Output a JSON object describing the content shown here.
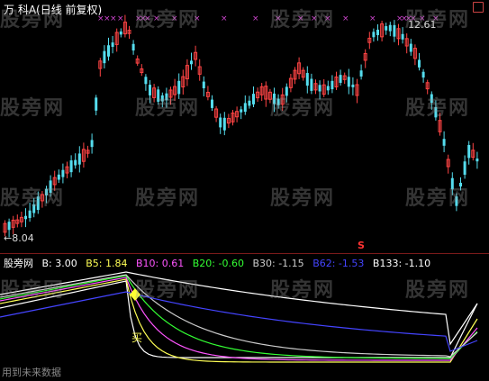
{
  "price_panel": {
    "title": "万 科A(日线 前复权)",
    "high_label": "12.61",
    "low_label": "←8.04",
    "s_marker": "S"
  },
  "indicator_panel": {
    "name": "股旁网",
    "items": [
      {
        "key": "B",
        "text": "B: 3.00",
        "color": "#ffffff"
      },
      {
        "key": "B5",
        "text": "B5: 1.84",
        "color": "#ffff55"
      },
      {
        "key": "B10",
        "text": "B10: 0.61",
        "color": "#ff55ff"
      },
      {
        "key": "B20",
        "text": "B20: -0.60",
        "color": "#33ff33"
      },
      {
        "key": "B30",
        "text": "B30: -1.15",
        "color": "#cccccc"
      },
      {
        "key": "B62",
        "text": "B62: -1.53",
        "color": "#4444ff"
      },
      {
        "key": "B133",
        "text": "B133: -1.10",
        "color": "#ffffff"
      }
    ],
    "bottom_text": "用到未来数据",
    "marker_text": "买"
  },
  "watermark": "股旁网",
  "colors": {
    "up": "#ff4444",
    "down": "#55ddee",
    "marker": "#cc44cc"
  }
}
